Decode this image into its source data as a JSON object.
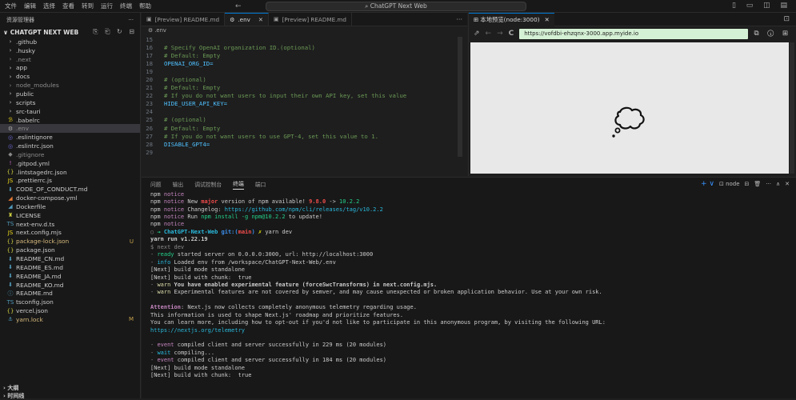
{
  "menubar": {
    "items": [
      "文件",
      "编辑",
      "选择",
      "查看",
      "转到",
      "运行",
      "终端",
      "帮助"
    ],
    "nav": "← →",
    "search": "ChatGPT Next Web",
    "layout_icons": "▯ ▭ ◫ ▤"
  },
  "sidebar": {
    "title": "资源管理器",
    "title_more": "···",
    "project": "CHATGPT NEXT WEB",
    "project_actions": "⎘ ⎗ ↻ ⊟",
    "items": [
      {
        "label": ".github",
        "ic": "›",
        "kind": "folder"
      },
      {
        "label": ".husky",
        "ic": "›",
        "kind": "folder"
      },
      {
        "label": ".next",
        "ic": "›",
        "kind": "folder-dim"
      },
      {
        "label": "app",
        "ic": "›",
        "kind": "folder"
      },
      {
        "label": "docs",
        "ic": "›",
        "kind": "folder"
      },
      {
        "label": "node_modules",
        "ic": "›",
        "kind": "folder-dim"
      },
      {
        "label": "public",
        "ic": "›",
        "kind": "folder"
      },
      {
        "label": "scripts",
        "ic": "›",
        "kind": "folder"
      },
      {
        "label": "src-tauri",
        "ic": "›",
        "kind": "folder"
      },
      {
        "label": ".babelrc",
        "ic": "ℬ",
        "color": "#f5de19"
      },
      {
        "label": ".env",
        "ic": "⚙",
        "color": "#aaa",
        "kind": "sel-dim"
      },
      {
        "label": ".eslintignore",
        "ic": "◎",
        "color": "#6c67d0"
      },
      {
        "label": ".eslintrc.json",
        "ic": "◎",
        "color": "#6c67d0"
      },
      {
        "label": ".gitignore",
        "ic": "◆",
        "color": "#888",
        "kind": "dim"
      },
      {
        "label": ".gitpod.yml",
        "ic": "!",
        "color": "#cb6fd0"
      },
      {
        "label": ".lintstagedrc.json",
        "ic": "{}",
        "color": "#cbcb41"
      },
      {
        "label": ".prettierrc.js",
        "ic": "JS",
        "color": "#f5de19"
      },
      {
        "label": "CODE_OF_CONDUCT.md",
        "ic": "⬇",
        "color": "#519aba"
      },
      {
        "label": "docker-compose.yml",
        "ic": "◢",
        "color": "#e37933"
      },
      {
        "label": "Dockerfile",
        "ic": "◢",
        "color": "#519aba"
      },
      {
        "label": "LICENSE",
        "ic": "♜",
        "color": "#cbcb41"
      },
      {
        "label": "next-env.d.ts",
        "ic": "TS",
        "color": "#519aba"
      },
      {
        "label": "next.config.mjs",
        "ic": "JS",
        "color": "#f5de19"
      },
      {
        "label": "package-lock.json",
        "ic": "{}",
        "color": "#cbcb41",
        "kind": "mod",
        "badge": "U"
      },
      {
        "label": "package.json",
        "ic": "{}",
        "color": "#cbcb41"
      },
      {
        "label": "README_CN.md",
        "ic": "⬇",
        "color": "#519aba"
      },
      {
        "label": "README_ES.md",
        "ic": "⬇",
        "color": "#519aba"
      },
      {
        "label": "README_JA.md",
        "ic": "⬇",
        "color": "#519aba"
      },
      {
        "label": "README_KO.md",
        "ic": "⬇",
        "color": "#519aba"
      },
      {
        "label": "README.md",
        "ic": "ⓘ",
        "color": "#519aba"
      },
      {
        "label": "tsconfig.json",
        "ic": "TS",
        "color": "#519aba"
      },
      {
        "label": "vercel.json",
        "ic": "{}",
        "color": "#cbcb41"
      },
      {
        "label": "yarn.lock",
        "ic": "⚓",
        "color": "#519aba",
        "kind": "mod",
        "badge": "M"
      }
    ],
    "outline": "› 大纲",
    "timeline": "› 时间线"
  },
  "editor": {
    "tabs": [
      {
        "label": "[Preview] README.md",
        "ic": "▣",
        "active": false
      },
      {
        "label": ".env",
        "ic": "⚙",
        "active": true,
        "close": "✕"
      },
      {
        "label": "[Preview] README.md",
        "ic": "▣",
        "active": false
      }
    ],
    "tabs_more": "···",
    "crumb": "⚙ .env",
    "lines": [
      {
        "n": "15",
        "t": "",
        "key": false
      },
      {
        "n": "16",
        "t": "# Specify OpenAI organization ID.(optional)",
        "key": false
      },
      {
        "n": "17",
        "t": "# Default: Empty",
        "key": false
      },
      {
        "n": "18",
        "t": "OPENAI_ORG_ID=",
        "key": true
      },
      {
        "n": "19",
        "t": "",
        "key": false
      },
      {
        "n": "20",
        "t": "# (optional)",
        "key": false
      },
      {
        "n": "21",
        "t": "# Default: Empty",
        "key": false
      },
      {
        "n": "22",
        "t": "# If you do not want users to input their own API key, set this value",
        "key": false
      },
      {
        "n": "23",
        "t": "HIDE_USER_API_KEY=",
        "key": true
      },
      {
        "n": "24",
        "t": "",
        "key": false
      },
      {
        "n": "25",
        "t": "# (optional)",
        "key": false
      },
      {
        "n": "26",
        "t": "# Default: Empty",
        "key": false
      },
      {
        "n": "27",
        "t": "# If you do not want users to use GPT-4, set this value to 1.",
        "key": false
      },
      {
        "n": "28",
        "t": "DISABLE_GPT4=",
        "key": true
      },
      {
        "n": "29",
        "t": "",
        "key": false
      }
    ]
  },
  "preview": {
    "tab_label": "⊞ 本地预览(node:3000)",
    "tab_close": "✕",
    "tab_icon": "⊡",
    "open_icon": "⇗",
    "back": "←",
    "forward": "→",
    "reload": "C",
    "url": "https://vofdbi-ehzqnx-3000.app.myide.io",
    "right_icons": "⧉ ⓘ ⊞"
  },
  "panel": {
    "tabs": [
      "问题",
      "输出",
      "调试控制台",
      "终端",
      "端口"
    ],
    "active_tab": 3,
    "tools": [
      "+ ∨",
      "⊡ node",
      "⊟",
      "🗑",
      "···",
      "∧",
      "✕"
    ]
  },
  "terminal": [
    [
      {
        "c": "npm ",
        "s": "npm"
      },
      {
        "c": "notice",
        "s": "c-purple"
      }
    ],
    [
      {
        "c": "npm ",
        "s": "npm"
      },
      {
        "c": "notice",
        "s": "c-purple"
      },
      {
        "c": " New ",
        "s": ""
      },
      {
        "c": "major",
        "s": "c-red-bold"
      },
      {
        "c": " version of npm available! ",
        "s": ""
      },
      {
        "c": "9.8.0",
        "s": "c-red-bold"
      },
      {
        "c": " -> ",
        "s": ""
      },
      {
        "c": "10.2.2",
        "s": "c-green"
      }
    ],
    [
      {
        "c": "npm ",
        "s": "npm"
      },
      {
        "c": "notice",
        "s": "c-purple"
      },
      {
        "c": " Changelog: ",
        "s": ""
      },
      {
        "c": "https://github.com/npm/cli/releases/tag/v10.2.2",
        "s": "c-cyan"
      }
    ],
    [
      {
        "c": "npm ",
        "s": "npm"
      },
      {
        "c": "notice",
        "s": "c-purple"
      },
      {
        "c": " Run ",
        "s": ""
      },
      {
        "c": "npm install -g npm@10.2.2",
        "s": "c-green"
      },
      {
        "c": " to update!",
        "s": ""
      }
    ],
    [
      {
        "c": "npm ",
        "s": "npm"
      },
      {
        "c": "notice",
        "s": "c-purple"
      }
    ],
    [
      {
        "c": "○ ",
        "s": "c-dim"
      },
      {
        "c": "→ ",
        "s": "c-grn-bold"
      },
      {
        "c": "ChatGPT-Next-Web ",
        "s": "c-cyan c-bold"
      },
      {
        "c": "git:(",
        "s": "c-blue-bold"
      },
      {
        "c": "main",
        "s": "c-red-bold"
      },
      {
        "c": ") ",
        "s": "c-blue-bold"
      },
      {
        "c": "✗ ",
        "s": "c-yellow"
      },
      {
        "c": "yarn dev",
        "s": ""
      }
    ],
    [
      {
        "c": "yarn run v1.22.19",
        "s": "c-bold"
      }
    ],
    [
      {
        "c": "$ next dev",
        "s": "c-dim"
      }
    ],
    [
      {
        "c": "- ",
        "s": "c-dim"
      },
      {
        "c": "ready",
        "s": "c-green"
      },
      {
        "c": " started server on 0.0.0.0:3000, url: http://localhost:3000",
        "s": ""
      }
    ],
    [
      {
        "c": "- ",
        "s": "c-dim"
      },
      {
        "c": "info",
        "s": "c-cyan"
      },
      {
        "c": " Loaded env from /workspace/ChatGPT-Next-Web/.env",
        "s": ""
      }
    ],
    [
      {
        "c": "[Next] build mode standalone",
        "s": ""
      }
    ],
    [
      {
        "c": "[Next] build with chunk:  true",
        "s": ""
      }
    ],
    [
      {
        "c": "- ",
        "s": "c-dim"
      },
      {
        "c": "warn",
        "s": "c-warn"
      },
      {
        "c": " You have enabled experimental feature (forceSwcTransforms) in next.config.mjs.",
        "s": "c-bold"
      }
    ],
    [
      {
        "c": "- ",
        "s": "c-dim"
      },
      {
        "c": "warn",
        "s": "c-warn"
      },
      {
        "c": " Experimental features are not covered by semver, and may cause unexpected or broken application behavior. Use at your own risk.",
        "s": ""
      }
    ],
    [
      {
        "c": "",
        "s": ""
      }
    ],
    [
      {
        "c": "Attention",
        "s": "c-att"
      },
      {
        "c": ": Next.js now collects completely anonymous telemetry regarding usage.",
        "s": ""
      }
    ],
    [
      {
        "c": "This information is used to shape Next.js' roadmap and prioritize features.",
        "s": ""
      }
    ],
    [
      {
        "c": "You can learn more, including how to opt-out if you'd not like to participate in this anonymous program, by visiting the following URL:",
        "s": ""
      }
    ],
    [
      {
        "c": "https://nextjs.org/telemetry",
        "s": "c-cyan"
      }
    ],
    [
      {
        "c": "",
        "s": ""
      }
    ],
    [
      {
        "c": "- ",
        "s": "c-dim"
      },
      {
        "c": "event",
        "s": "c-purple"
      },
      {
        "c": " compiled client and server successfully in 229 ms (20 modules)",
        "s": ""
      }
    ],
    [
      {
        "c": "- ",
        "s": "c-dim"
      },
      {
        "c": "wait",
        "s": "c-cyan"
      },
      {
        "c": " compiling...",
        "s": ""
      }
    ],
    [
      {
        "c": "- ",
        "s": "c-dim"
      },
      {
        "c": "event",
        "s": "c-purple"
      },
      {
        "c": " compiled client and server successfully in 184 ms (20 modules)",
        "s": ""
      }
    ],
    [
      {
        "c": "[Next] build mode standalone",
        "s": ""
      }
    ],
    [
      {
        "c": "[Next] build with chunk:  true",
        "s": ""
      }
    ]
  ]
}
